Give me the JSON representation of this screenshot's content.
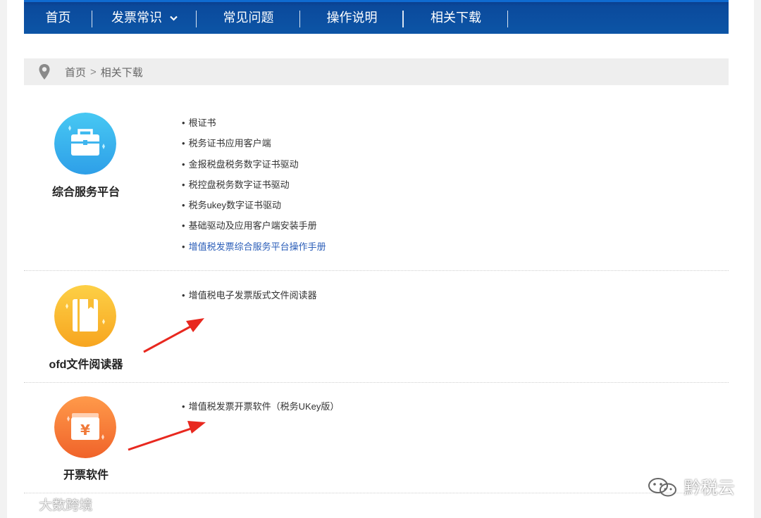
{
  "nav": {
    "items": [
      {
        "label": "首页"
      },
      {
        "label": "发票常识"
      },
      {
        "label": "常见问题"
      },
      {
        "label": "操作说明"
      },
      {
        "label": "相关下载"
      }
    ]
  },
  "breadcrumb": {
    "home": "首页",
    "separator": ">",
    "current": "相关下载"
  },
  "sections": [
    {
      "title": "综合服务平台",
      "icon": "briefcase-icon",
      "links": [
        "根证书",
        "税务证书应用客户端",
        "金报税盘税务数字证书驱动",
        "税控盘税务数字证书驱动",
        "税务ukey数字证书驱动",
        "基础驱动及应用客户端安装手册",
        "增值税发票综合服务平台操作手册"
      ]
    },
    {
      "title": "ofd文件阅读器",
      "icon": "book-icon",
      "links": [
        "增值税电子发票版式文件阅读器"
      ]
    },
    {
      "title": "开票软件",
      "icon": "invoice-yuan-icon",
      "links": [
        "增值税发票开票软件（税务UKey版）"
      ]
    }
  ],
  "watermarks": {
    "left": "大数跨境",
    "right": "黔税云"
  },
  "colors": {
    "nav_bg": "#0c55a6",
    "link_highlight": "#2a5db8",
    "arrow": "#e8281f"
  }
}
